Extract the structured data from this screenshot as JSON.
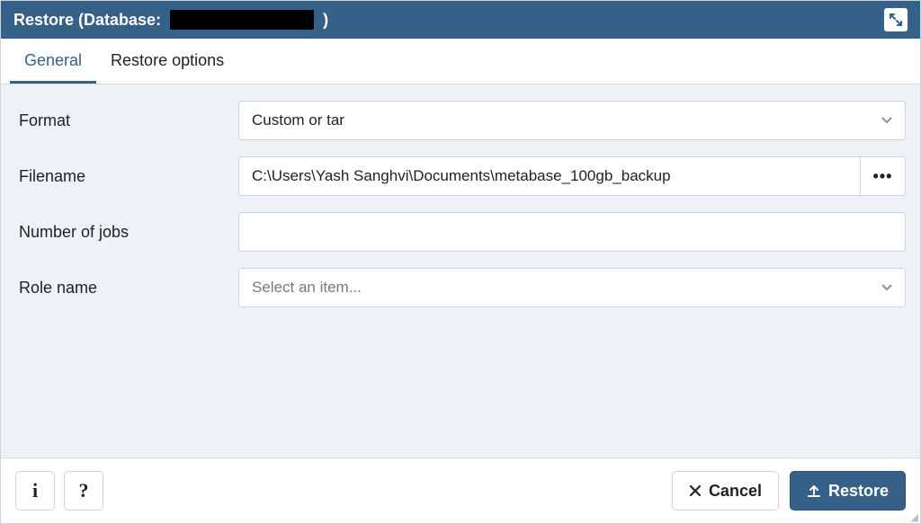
{
  "title_prefix": "Restore (Database:",
  "title_suffix": ")",
  "tabs": {
    "general": "General",
    "restore_options": "Restore options"
  },
  "labels": {
    "format": "Format",
    "filename": "Filename",
    "jobs": "Number of jobs",
    "role": "Role name"
  },
  "values": {
    "format": "Custom or tar",
    "filename": "C:\\Users\\Yash Sanghvi\\Documents\\metabase_100gb_backup",
    "jobs": "",
    "role_placeholder": "Select an item..."
  },
  "buttons": {
    "cancel": "Cancel",
    "restore": "Restore"
  },
  "icons": {
    "file_browse": "•••"
  },
  "colors": {
    "accent": "#356189"
  }
}
